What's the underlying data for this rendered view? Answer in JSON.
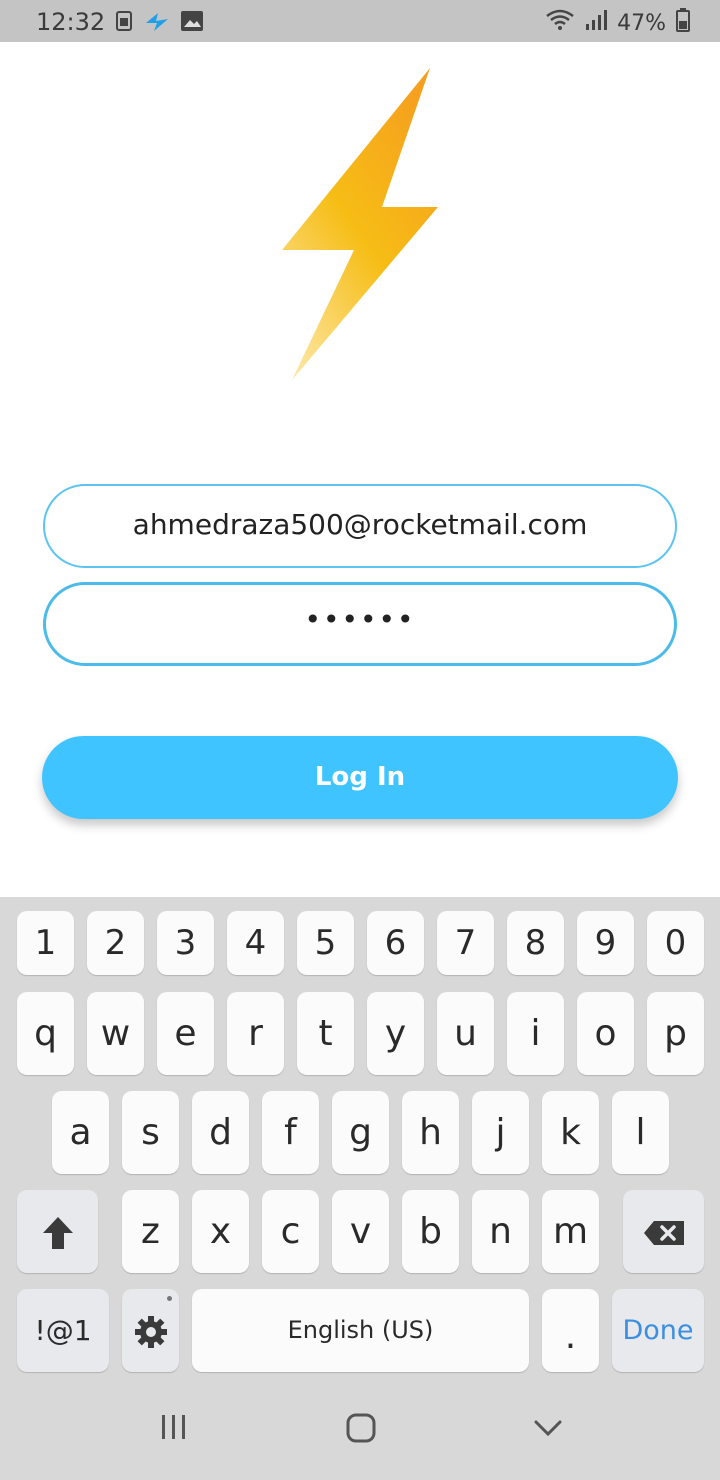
{
  "status_bar": {
    "time": "12:32",
    "battery": "47%",
    "icons_left": [
      "sim-icon",
      "telenor-icon",
      "image-icon"
    ],
    "icons_right": [
      "wifi-icon",
      "signal-icon",
      "battery-icon"
    ]
  },
  "logo": {
    "icon": "lightning-bolt-icon",
    "colors": [
      "#f5a623",
      "#f7c11b",
      "#fde39a"
    ]
  },
  "login_form": {
    "email_value": "ahmedraza500@rocketmail.com",
    "password_value": "••••••",
    "login_label": "Log In"
  },
  "keyboard": {
    "number_row": [
      "1",
      "2",
      "3",
      "4",
      "5",
      "6",
      "7",
      "8",
      "9",
      "0"
    ],
    "row1": [
      "q",
      "w",
      "e",
      "r",
      "t",
      "y",
      "u",
      "i",
      "o",
      "p"
    ],
    "row2": [
      "a",
      "s",
      "d",
      "f",
      "g",
      "h",
      "j",
      "k",
      "l"
    ],
    "row3": [
      "z",
      "x",
      "c",
      "v",
      "b",
      "n",
      "m"
    ],
    "symbols_label": "!@1",
    "space_label": "English (US)",
    "period_label": ".",
    "done_label": "Done"
  },
  "colors": {
    "accent": "#40c4ff",
    "field_border": "#5cc4ee",
    "done_text": "#3b8fe0"
  }
}
